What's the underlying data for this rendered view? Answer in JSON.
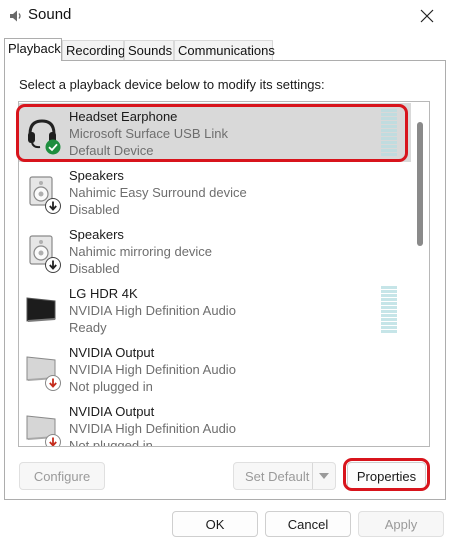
{
  "window": {
    "title": "Sound",
    "icons": {
      "app": "speaker-icon",
      "close": "close-icon"
    }
  },
  "tabs": [
    {
      "label": "Playback",
      "active": true
    },
    {
      "label": "Recording",
      "active": false
    },
    {
      "label": "Sounds",
      "active": false
    },
    {
      "label": "Communications",
      "active": false
    }
  ],
  "playback": {
    "instruction": "Select a playback device below to modify its settings:",
    "devices": [
      {
        "name": "Headset Earphone",
        "description": "Microsoft Surface USB Link",
        "status": "Default Device",
        "icon": "headset-icon",
        "badge": "default-check-icon",
        "selected": true
      },
      {
        "name": "Speakers",
        "description": "Nahimic Easy Surround device",
        "status": "Disabled",
        "icon": "speaker-icon",
        "badge": "disabled-arrow-icon",
        "selected": false
      },
      {
        "name": "Speakers",
        "description": "Nahimic mirroring device",
        "status": "Disabled",
        "icon": "speaker-icon",
        "badge": "disabled-arrow-icon",
        "selected": false
      },
      {
        "name": "LG HDR 4K",
        "description": "NVIDIA High Definition Audio",
        "status": "Ready",
        "icon": "monitor-icon",
        "badge": "",
        "selected": false
      },
      {
        "name": "NVIDIA Output",
        "description": "NVIDIA High Definition Audio",
        "status": "Not plugged in",
        "icon": "monitor-icon",
        "badge": "unplugged-arrow-icon",
        "selected": false
      },
      {
        "name": "NVIDIA Output",
        "description": "NVIDIA High Definition Audio",
        "status": "Not plugged in",
        "icon": "monitor-icon",
        "badge": "unplugged-arrow-icon",
        "selected": false
      }
    ],
    "buttons": {
      "configure": "Configure",
      "set_default": "Set Default",
      "properties": "Properties"
    }
  },
  "footer": {
    "ok": "OK",
    "cancel": "Cancel",
    "apply": "Apply"
  },
  "colors": {
    "highlight": "#d8141c",
    "selected_row": "#d9d9d9",
    "check_badge": "#1e8e3e",
    "unplugged_badge": "#c42b1c"
  }
}
